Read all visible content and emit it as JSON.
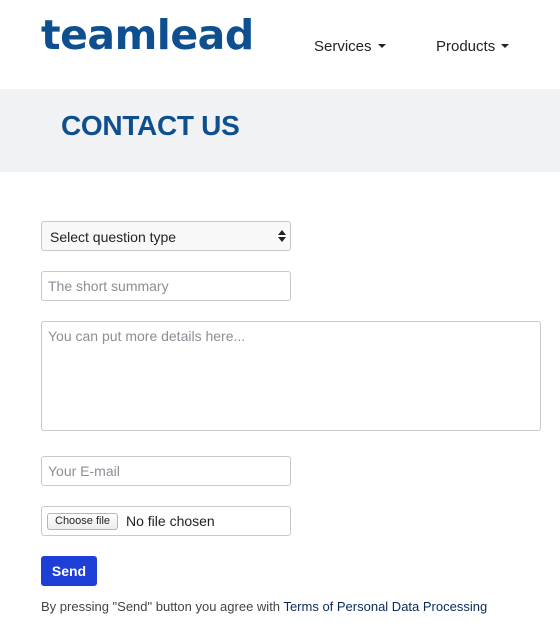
{
  "brand": {
    "logo_text": "teamlead",
    "accent_color": "#0e4f8f"
  },
  "nav": {
    "items": [
      {
        "label": "Services"
      },
      {
        "label": "Products"
      }
    ]
  },
  "banner": {
    "title": "CONTACT US"
  },
  "form": {
    "question_type": {
      "selected": "Select question type"
    },
    "summary": {
      "value": "",
      "placeholder": "The short summary"
    },
    "details": {
      "value": "",
      "placeholder": "You can put more details here..."
    },
    "email": {
      "value": "",
      "placeholder": "Your E-mail"
    },
    "file": {
      "button_label": "Choose file",
      "status": "No file chosen"
    },
    "send_label": "Send",
    "send_color": "#1e3fd6"
  },
  "consent": {
    "text": "By pressing \"Send\" button you agree with",
    "link_text": "Terms of Personal Data Processing"
  }
}
